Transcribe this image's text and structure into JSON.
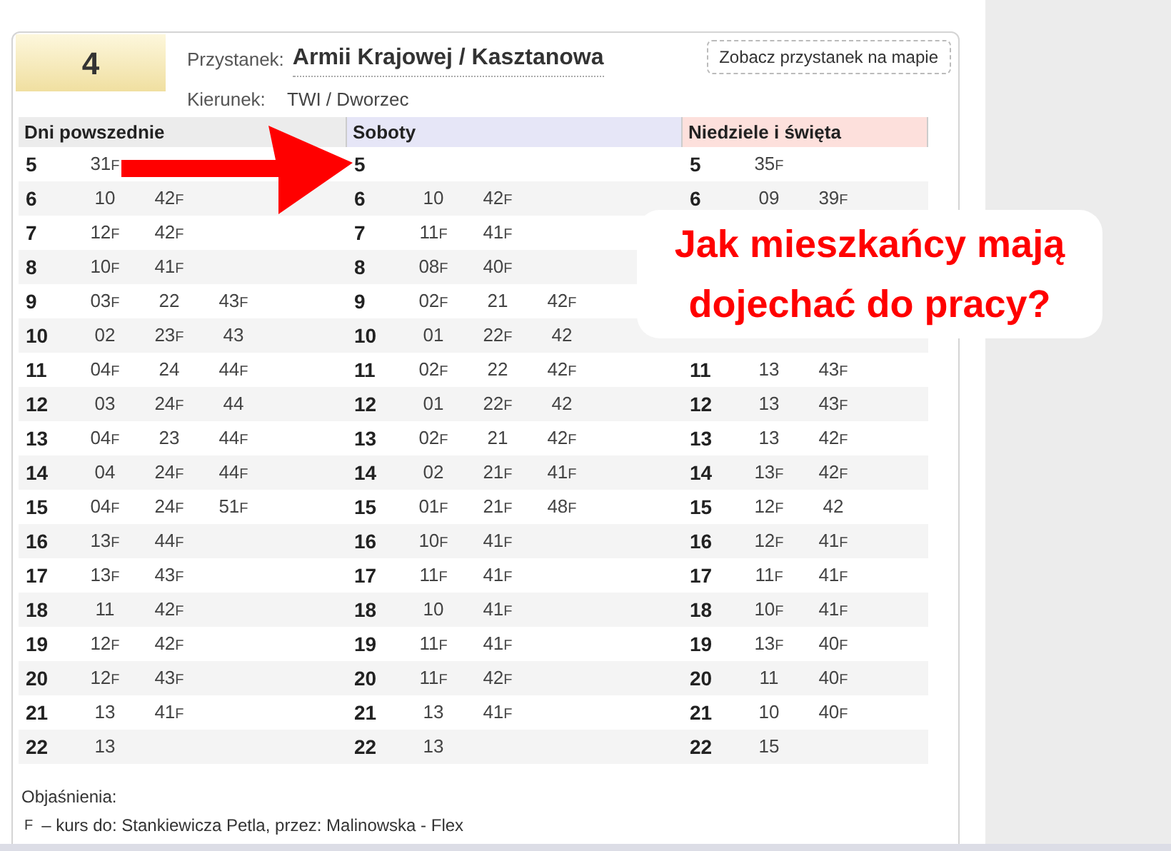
{
  "route": {
    "number": "4"
  },
  "stop": {
    "label": "Przystanek:",
    "name": "Armii Krajowej / Kasztanowa",
    "direction_label": "Kierunek:",
    "direction": "TWI / Dworzec",
    "map_button": "Zobacz przystanek na mapie"
  },
  "table": {
    "columns": [
      {
        "title": "Dni powszednie",
        "color": "#ececec"
      },
      {
        "title": "Soboty",
        "color": "#e6e6f7"
      },
      {
        "title": "Niedziele i święta",
        "color": "#fde0dc"
      }
    ],
    "rows": [
      {
        "cells": [
          {
            "hour": "5",
            "minutes": [
              {
                "t": "31",
                "n": "F"
              }
            ]
          },
          {
            "hour": "5"
          },
          {
            "hour": "5",
            "minutes": [
              {
                "t": "35",
                "n": "F"
              }
            ]
          }
        ]
      },
      {
        "cells": [
          {
            "hour": "6",
            "minutes": [
              {
                "t": "10"
              },
              {
                "t": "42",
                "n": "F"
              }
            ]
          },
          {
            "hour": "6",
            "minutes": [
              {
                "t": "10"
              },
              {
                "t": "42",
                "n": "F"
              }
            ]
          },
          {
            "hour": "6",
            "minutes": [
              {
                "t": "09"
              },
              {
                "t": "39",
                "n": "F"
              }
            ]
          }
        ]
      },
      {
        "cells": [
          {
            "hour": "7",
            "minutes": [
              {
                "t": "12",
                "n": "F"
              },
              {
                "t": "42",
                "n": "F"
              }
            ]
          },
          {
            "hour": "7",
            "minutes": [
              {
                "t": "11",
                "n": "F"
              },
              {
                "t": "41",
                "n": "F"
              }
            ]
          },
          null
        ]
      },
      {
        "cells": [
          {
            "hour": "8",
            "minutes": [
              {
                "t": "10",
                "n": "F"
              },
              {
                "t": "41",
                "n": "F"
              }
            ]
          },
          {
            "hour": "8",
            "minutes": [
              {
                "t": "08",
                "n": "F"
              },
              {
                "t": "40",
                "n": "F"
              }
            ]
          },
          null
        ]
      },
      {
        "cells": [
          {
            "hour": "9",
            "minutes": [
              {
                "t": "03",
                "n": "F"
              },
              {
                "t": "22"
              },
              {
                "t": "43",
                "n": "F"
              }
            ]
          },
          {
            "hour": "9",
            "minutes": [
              {
                "t": "02",
                "n": "F"
              },
              {
                "t": "21"
              },
              {
                "t": "42",
                "n": "F"
              }
            ]
          },
          null
        ]
      },
      {
        "cells": [
          {
            "hour": "10",
            "minutes": [
              {
                "t": "02"
              },
              {
                "t": "23",
                "n": "F"
              },
              {
                "t": "43"
              }
            ]
          },
          {
            "hour": "10",
            "minutes": [
              {
                "t": "01"
              },
              {
                "t": "22",
                "n": "F"
              },
              {
                "t": "42"
              }
            ]
          },
          null
        ]
      },
      {
        "cells": [
          {
            "hour": "11",
            "minutes": [
              {
                "t": "04",
                "n": "F"
              },
              {
                "t": "24"
              },
              {
                "t": "44",
                "n": "F"
              }
            ]
          },
          {
            "hour": "11",
            "minutes": [
              {
                "t": "02",
                "n": "F"
              },
              {
                "t": "22"
              },
              {
                "t": "42",
                "n": "F"
              }
            ]
          },
          {
            "hour": "11",
            "minutes": [
              {
                "t": "13"
              },
              {
                "t": "43",
                "n": "F"
              }
            ]
          }
        ]
      },
      {
        "cells": [
          {
            "hour": "12",
            "minutes": [
              {
                "t": "03"
              },
              {
                "t": "24",
                "n": "F"
              },
              {
                "t": "44"
              }
            ]
          },
          {
            "hour": "12",
            "minutes": [
              {
                "t": "01"
              },
              {
                "t": "22",
                "n": "F"
              },
              {
                "t": "42"
              }
            ]
          },
          {
            "hour": "12",
            "minutes": [
              {
                "t": "13"
              },
              {
                "t": "43",
                "n": "F"
              }
            ]
          }
        ]
      },
      {
        "cells": [
          {
            "hour": "13",
            "minutes": [
              {
                "t": "04",
                "n": "F"
              },
              {
                "t": "23"
              },
              {
                "t": "44",
                "n": "F"
              }
            ]
          },
          {
            "hour": "13",
            "minutes": [
              {
                "t": "02",
                "n": "F"
              },
              {
                "t": "21"
              },
              {
                "t": "42",
                "n": "F"
              }
            ]
          },
          {
            "hour": "13",
            "minutes": [
              {
                "t": "13"
              },
              {
                "t": "42",
                "n": "F"
              }
            ]
          }
        ]
      },
      {
        "cells": [
          {
            "hour": "14",
            "minutes": [
              {
                "t": "04"
              },
              {
                "t": "24",
                "n": "F"
              },
              {
                "t": "44",
                "n": "F"
              }
            ]
          },
          {
            "hour": "14",
            "minutes": [
              {
                "t": "02"
              },
              {
                "t": "21",
                "n": "F"
              },
              {
                "t": "41",
                "n": "F"
              }
            ]
          },
          {
            "hour": "14",
            "minutes": [
              {
                "t": "13",
                "n": "F"
              },
              {
                "t": "42",
                "n": "F"
              }
            ]
          }
        ]
      },
      {
        "cells": [
          {
            "hour": "15",
            "minutes": [
              {
                "t": "04",
                "n": "F"
              },
              {
                "t": "24",
                "n": "F"
              },
              {
                "t": "51",
                "n": "F"
              }
            ]
          },
          {
            "hour": "15",
            "minutes": [
              {
                "t": "01",
                "n": "F"
              },
              {
                "t": "21",
                "n": "F"
              },
              {
                "t": "48",
                "n": "F"
              }
            ]
          },
          {
            "hour": "15",
            "minutes": [
              {
                "t": "12",
                "n": "F"
              },
              {
                "t": "42"
              }
            ]
          }
        ]
      },
      {
        "cells": [
          {
            "hour": "16",
            "minutes": [
              {
                "t": "13",
                "n": "F"
              },
              {
                "t": "44",
                "n": "F"
              }
            ]
          },
          {
            "hour": "16",
            "minutes": [
              {
                "t": "10",
                "n": "F"
              },
              {
                "t": "41",
                "n": "F"
              }
            ]
          },
          {
            "hour": "16",
            "minutes": [
              {
                "t": "12",
                "n": "F"
              },
              {
                "t": "41",
                "n": "F"
              }
            ]
          }
        ]
      },
      {
        "cells": [
          {
            "hour": "17",
            "minutes": [
              {
                "t": "13",
                "n": "F"
              },
              {
                "t": "43",
                "n": "F"
              }
            ]
          },
          {
            "hour": "17",
            "minutes": [
              {
                "t": "11",
                "n": "F"
              },
              {
                "t": "41",
                "n": "F"
              }
            ]
          },
          {
            "hour": "17",
            "minutes": [
              {
                "t": "11",
                "n": "F"
              },
              {
                "t": "41",
                "n": "F"
              }
            ]
          }
        ]
      },
      {
        "cells": [
          {
            "hour": "18",
            "minutes": [
              {
                "t": "11"
              },
              {
                "t": "42",
                "n": "F"
              }
            ]
          },
          {
            "hour": "18",
            "minutes": [
              {
                "t": "10"
              },
              {
                "t": "41",
                "n": "F"
              }
            ]
          },
          {
            "hour": "18",
            "minutes": [
              {
                "t": "10",
                "n": "F"
              },
              {
                "t": "41",
                "n": "F"
              }
            ]
          }
        ]
      },
      {
        "cells": [
          {
            "hour": "19",
            "minutes": [
              {
                "t": "12",
                "n": "F"
              },
              {
                "t": "42",
                "n": "F"
              }
            ]
          },
          {
            "hour": "19",
            "minutes": [
              {
                "t": "11",
                "n": "F"
              },
              {
                "t": "41",
                "n": "F"
              }
            ]
          },
          {
            "hour": "19",
            "minutes": [
              {
                "t": "13",
                "n": "F"
              },
              {
                "t": "40",
                "n": "F"
              }
            ]
          }
        ]
      },
      {
        "cells": [
          {
            "hour": "20",
            "minutes": [
              {
                "t": "12",
                "n": "F"
              },
              {
                "t": "43",
                "n": "F"
              }
            ]
          },
          {
            "hour": "20",
            "minutes": [
              {
                "t": "11",
                "n": "F"
              },
              {
                "t": "42",
                "n": "F"
              }
            ]
          },
          {
            "hour": "20",
            "minutes": [
              {
                "t": "11"
              },
              {
                "t": "40",
                "n": "F"
              }
            ]
          }
        ]
      },
      {
        "cells": [
          {
            "hour": "21",
            "minutes": [
              {
                "t": "13"
              },
              {
                "t": "41",
                "n": "F"
              }
            ]
          },
          {
            "hour": "21",
            "minutes": [
              {
                "t": "13"
              },
              {
                "t": "41",
                "n": "F"
              }
            ]
          },
          {
            "hour": "21",
            "minutes": [
              {
                "t": "10"
              },
              {
                "t": "40",
                "n": "F"
              }
            ]
          }
        ]
      },
      {
        "cells": [
          {
            "hour": "22",
            "minutes": [
              {
                "t": "13"
              }
            ]
          },
          {
            "hour": "22",
            "minutes": [
              {
                "t": "13"
              }
            ]
          },
          {
            "hour": "22",
            "minutes": [
              {
                "t": "15"
              }
            ]
          }
        ]
      }
    ]
  },
  "legend": {
    "title": "Objaśnienia:",
    "items": [
      {
        "mark": "F",
        "text": "– kurs do: Stankiewicza Petla, przez: Malinowska - Flex"
      }
    ]
  },
  "callout": {
    "text": "Jak mieszkańcy mają dojechać do pracy?"
  }
}
